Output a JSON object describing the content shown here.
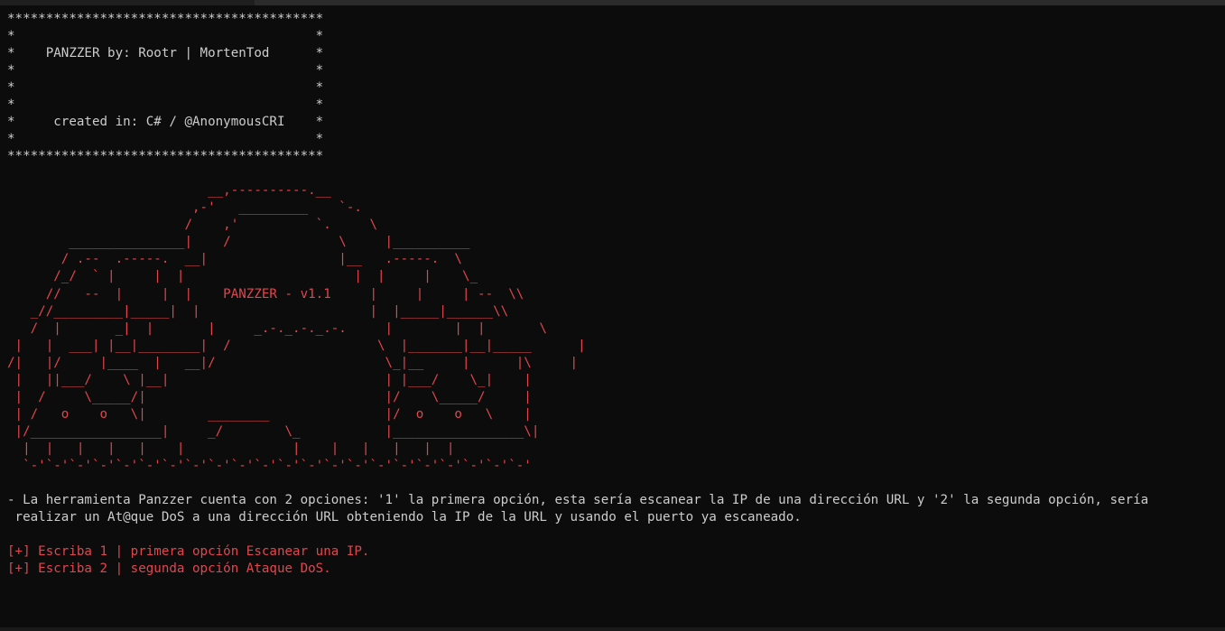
{
  "banner": {
    "lines": [
      "*****************************************",
      "*                                       *",
      "*    PANZZER by: Rootr | MortenTod      *",
      "*                                       *",
      "*                                       *",
      "*                                       *",
      "*     created in: C# / @AnonymousCRI    *",
      "*                                       *",
      "*****************************************"
    ]
  },
  "ascii_art": {
    "lines": [
      "                          __,----------.__",
      "                        ,-'   _________    `-.",
      "                       /    ,'          `.     \\",
      "        _______________|    /              \\     |__________",
      "       / .--  .-----.  __|                 |__   .-----.  \\",
      "      /_/  ` |     |  |                      |  |     |    \\_",
      "     //   --  |     |  |    PANZZER - v1.1     |     |     | --  \\\\",
      "   _//_________|_____|  |                      |  |_____|______\\\\",
      "   /  |       _|  |       |     _.-._.-._.-.     |        |  |       \\",
      " |   |  ___| |__|________|  /                   \\  |_______|__|_____      |",
      "/|   |/     |____  |   __|/                      \\_|__     |      |\\     |",
      " |   ||___/    \\ |__|                            | |___/    \\_|    |",
      " |  /     \\_____/|                               |/    \\_____/     |",
      " | /   o    o   \\|        ________               |/  o    o   \\    |",
      " |/_________________|     _/        \\_           |_________________\\|",
      "  |  |   |   |   |    |              |    |   |   |   |  |",
      "  `-'`-'`-'`-'`-'`-'`-'`-'`-'`-'`-'`-'`-'`-'`-'`-'`-'`-'`-'`-'`-'`-'"
    ]
  },
  "description": {
    "line1": "- La herramienta Panzzer cuenta con 2 opciones: '1' la primera opción, esta sería escanear la IP de una dirección URL y '2' la segunda opción, sería",
    "line2": " realizar un At@que DoS a una dirección URL obteniendo la IP de la URL y usando el puerto ya escaneado."
  },
  "options": {
    "option1": "[+] Escriba 1 | primera opción Escanear una IP.",
    "option2": "[+] Escriba 2 | segunda opción Ataque DoS."
  },
  "colors": {
    "background": "#0c0c0c",
    "text": "#cccccc",
    "accent_red": "#e0464e"
  }
}
